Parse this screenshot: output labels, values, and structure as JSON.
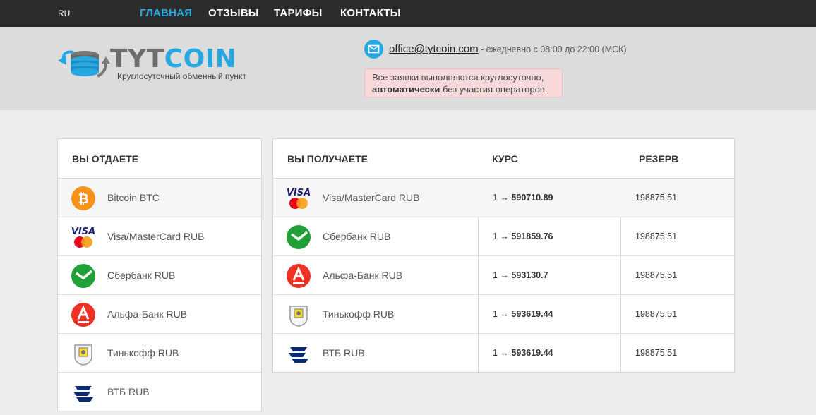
{
  "topbar": {
    "lang": "RU",
    "nav": [
      {
        "label": "ГЛАВНАЯ",
        "active": true
      },
      {
        "label": "ОТЗЫВЫ",
        "active": false
      },
      {
        "label": "ТАРИФЫ",
        "active": false
      },
      {
        "label": "КОНТАКТЫ",
        "active": false
      }
    ]
  },
  "header": {
    "logo": {
      "part1": "TYT",
      "part2": "COIN",
      "subtitle": "Круглосуточный обменный пункт"
    },
    "email": "office@tytcoin.com",
    "hours": "- ежедневно с 08:00 до 22:00 (МСК)",
    "notice": {
      "line1": "Все заявки выполняются круглосуточно,",
      "bold": "автоматически",
      "rest": " без участия операторов."
    }
  },
  "give": {
    "title": "ВЫ ОТДАЕТЕ",
    "items": [
      {
        "label": "Bitcoin BTC",
        "icon": "bitcoin-icon",
        "selected": true
      },
      {
        "label": "Visa/MasterCard RUB",
        "icon": "visa-mastercard-icon"
      },
      {
        "label": "Сбербанк RUB",
        "icon": "sberbank-icon"
      },
      {
        "label": "Альфа-Банк RUB",
        "icon": "alfabank-icon"
      },
      {
        "label": "Тинькофф RUB",
        "icon": "tinkoff-icon"
      },
      {
        "label": "ВТБ RUB",
        "icon": "vtb-icon"
      }
    ]
  },
  "receive": {
    "title": "ВЫ ПОЛУЧАЕТЕ",
    "rate_title": "КУРС",
    "reserve_title": "РЕЗЕРВ",
    "rows": [
      {
        "label": "Visa/MasterCard RUB",
        "icon": "visa-mastercard-icon",
        "rate_from": "1 →",
        "rate_to": "590710.89",
        "reserve": "198875.51"
      },
      {
        "label": "Сбербанк RUB",
        "icon": "sberbank-icon",
        "rate_from": "1 →",
        "rate_to": "591859.76",
        "reserve": "198875.51"
      },
      {
        "label": "Альфа-Банк RUB",
        "icon": "alfabank-icon",
        "rate_from": "1 →",
        "rate_to": "593130.7",
        "reserve": "198875.51"
      },
      {
        "label": "Тинькофф RUB",
        "icon": "tinkoff-icon",
        "rate_from": "1 →",
        "rate_to": "593619.44",
        "reserve": "198875.51"
      },
      {
        "label": "ВТБ RUB",
        "icon": "vtb-icon",
        "rate_from": "1 →",
        "rate_to": "593619.44",
        "reserve": "198875.51"
      }
    ]
  },
  "colors": {
    "accent": "#28a8e0",
    "topbar": "#2b2b2b",
    "header_bg": "#dcdcdc",
    "page_bg": "#ececec",
    "notice_bg": "#f7d8db"
  }
}
